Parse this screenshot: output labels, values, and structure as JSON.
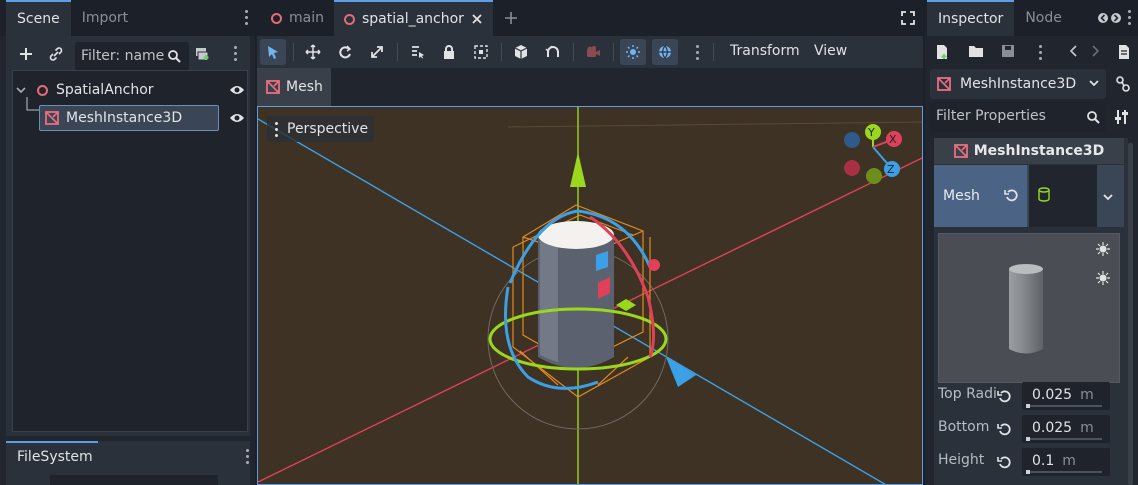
{
  "left_dock": {
    "tabs": [
      {
        "label": "Scene",
        "active": true
      },
      {
        "label": "Import",
        "active": false
      }
    ],
    "filter_placeholder": "Filter: name",
    "tree": [
      {
        "label": "SpatialAnchor",
        "icon": "spatial-node-icon",
        "expanded": true,
        "selected": false
      },
      {
        "label": "MeshInstance3D",
        "icon": "mesh-instance-icon",
        "selected": true
      }
    ],
    "filesystem_tab": "FileSystem"
  },
  "center": {
    "tabs": [
      {
        "label": "main",
        "active": false
      },
      {
        "label": "spatial_anchor",
        "active": true
      }
    ],
    "toolbar": {
      "transform_label": "Transform",
      "view_label": "View"
    },
    "mesh_menu": "Mesh",
    "viewport": {
      "perspective_label": "Perspective",
      "gizmo_axes": {
        "x": "X",
        "y": "Y",
        "z": "Z"
      }
    }
  },
  "right_dock": {
    "tabs": [
      {
        "label": "Inspector",
        "active": true
      },
      {
        "label": "Node",
        "active": false
      }
    ],
    "node_select": "MeshInstance3D",
    "filter_placeholder": "Filter Properties",
    "header": "MeshInstance3D",
    "mesh_property": "Mesh",
    "properties": [
      {
        "name": "Top Radius",
        "display": "Top Radi",
        "value": "0.025",
        "unit": "m"
      },
      {
        "name": "Bottom Radius",
        "display": "Bottom",
        "value": "0.025",
        "unit": "m"
      },
      {
        "name": "Height",
        "display": "Height",
        "value": "0.1",
        "unit": "m"
      }
    ]
  },
  "colors": {
    "accent": "#5e9ee8",
    "x_axis": "#e0415a",
    "y_axis": "#9ad81e",
    "z_axis": "#3ca0e6",
    "viewport_bg": "#3e3224"
  }
}
